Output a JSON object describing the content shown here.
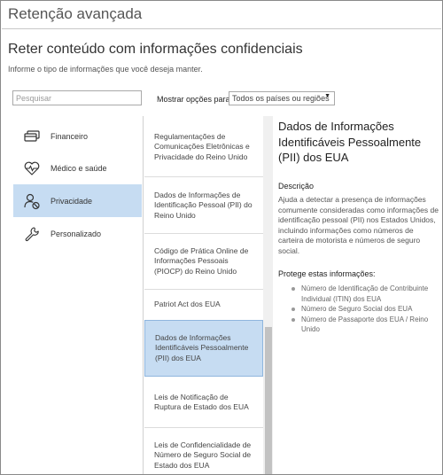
{
  "window": {
    "title": "Retenção avançada"
  },
  "section": {
    "title": "Reter conteúdo com informações confidenciais",
    "instruction": "Informe o tipo de informações que você deseja manter."
  },
  "search": {
    "placeholder": "Pesquisar"
  },
  "filter": {
    "label": "Mostrar opções para",
    "selected": "Todos os países ou regiões"
  },
  "categories": [
    {
      "label": "Financeiro",
      "icon": "credit-card-icon"
    },
    {
      "label": "Médico e saúde",
      "icon": "heart-pulse-icon"
    },
    {
      "label": "Privacidade",
      "icon": "person-block-icon",
      "selected": true
    },
    {
      "label": "Personalizado",
      "icon": "wrench-icon"
    }
  ],
  "templates": [
    {
      "label": "Regulamentações de Comunicações Eletrônicas e Privacidade do Reino Unido"
    },
    {
      "label": "Dados de Informações de Identificação Pessoal (PII) do Reino Unido"
    },
    {
      "label": "Código de Prática Online de Informações Pessoais (PIOCP)  do Reino Unido"
    },
    {
      "label": "Patriot Act dos EUA"
    },
    {
      "label": "Dados de Informações Identificáveis Pessoalmente (PII) dos EUA",
      "selected": true
    },
    {
      "label": "Leis de Notificação de Ruptura de Estado dos EUA"
    },
    {
      "label": "Leis de Confidencialidade de Número de Seguro Social de Estado dos EUA"
    }
  ],
  "detail": {
    "title": "Dados de Informações Identificáveis Pessoalmente (PII) dos EUA",
    "description_label": "Descrição",
    "description": "Ajuda a detectar a presença de informações comumente consideradas como informações de identificação pessoal (PII) nos Estados Unidos, incluindo informações como números de carteira de motorista e números de seguro social.",
    "protects_label": "Protege estas informações:",
    "protects": [
      "Número de Identificação de Contribuinte Individual (ITIN) dos EUA",
      "Número de Seguro Social dos EUA",
      "Número de Passaporte dos EUA / Reino Unido"
    ]
  },
  "colors": {
    "selected": "#c6dcf2",
    "selected_border": "#8fb6de",
    "icon": "#333333"
  }
}
